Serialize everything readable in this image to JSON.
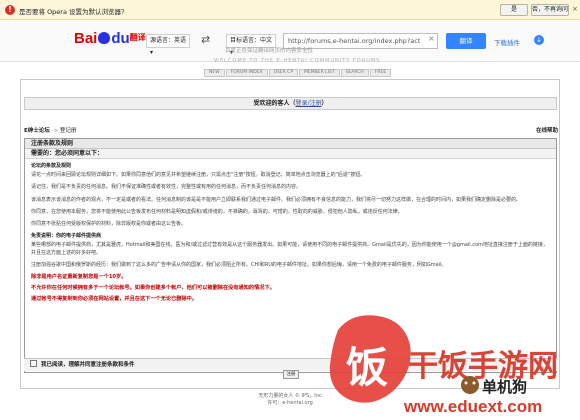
{
  "notify_bar": {
    "message": "是否要将 Opera 设置为默认浏览器？",
    "yes_label": "是",
    "no_label": "否，不再询问",
    "close_glyph": "×"
  },
  "translate_bar": {
    "logo_bai": "Bai",
    "logo_du": "du",
    "logo_fanyi": "翻译",
    "source_lang": "源语言：英语 ▾",
    "swap_glyph": "⇄",
    "target_lang": "目标语言：中文 ▾",
    "url_value": "http://forums.e-hentai.org/index.php?act",
    "clear_glyph": "×",
    "translate_button": "翻译",
    "download_plugin": "下载插件",
    "download_glyph": "↓",
    "hint": "百度正在保证翻译网页的内容安全性"
  },
  "forum_header": {
    "caption": "WELCOME TO THE E-HENTAI COMMUNITY FORUMS",
    "nav": [
      "NEW",
      "FORUM INDEX",
      "USER CP",
      "MEMBER LIST",
      "SEARCH",
      "FREE"
    ]
  },
  "welcome": {
    "text": "受欢迎的客人（",
    "link": "登录/注册",
    "text_end": "）"
  },
  "breadcrumb": {
    "home": "E绅士论坛",
    "sep": "->",
    "current": "登记册"
  },
  "faq_link": "在线帮助",
  "panel": {
    "title": "注册条款及规则",
    "subtitle": "需要的：您必须同意以下：",
    "section1_title": "论坛的条款及规则",
    "para1": "请花一点时间来回顾论坛规则详细如下。如果你同意他们的意见并希望继续注册，只需点击\"注册\"按钮。取消登记，简单地点击浏览器上的\"后退\"按钮。",
    "para2": "请记住，我们是不负责的任何消息。我们不保证准确性或者有效性，完整性或有用的任何消息，而不负责任何消息的内容。",
    "para3": "该消息表示该消息的作者的观点，不一定是或者的看法。任何消息制的该是是不能用户立即联系我们通过电子邮件。我们必须拥有不良信息的能力，我们将尽一切努力这样做，在合理的时间内，如果我们确定删除是必要的。",
    "para4": "你同意，在您使用本服务，您将不能使用此公告板发布任何材料是明知虚假和/或诽谤的，不准确的，辱骂的，可憎的，性取向的威胁，侵犯他人隐私，或违反任何法律。",
    "para5": "你同意不张贴任何受版权保护的材料，除非版权是你或者由这公告板。",
    "section2_title": "免责说明：你的电子邮件提供商",
    "para6": "某些哪部的电子邮件提供商，尤其是雅虎，Hotmail和美国在线，医为和/或过滤过营有效是从这个服务器发出。如果可能，请使用不同的电子邮件提供商。Gmail是优先的，因为你能使用一个@gmail.com地址直接注册于上面的链接，并且在这方面上述的好多好吧。",
    "para7": "注册加强谷歌中国和俄罗斯的经历：我们做到了这么多的广告申请从你的国家，我们必须阻止所有。CHI和RU的电子邮件地址。如果你想后悔，请用一个免费的电子邮件服务，例如Gmail。",
    "red1": "除非是用户名证重新复制您是一个10岁。",
    "red2": "不允许你在任何时候拥有多于一个论坛帐号。如果你创建多个帐户，他们可以被删除在没有通知的情况下。",
    "red3": "通过帐号不得复制到你必须在网站设置，并且在这下一个无论已删除中。",
    "agree_label": "我已阅读，理解并同意注册条款和条件",
    "register_button": "注册"
  },
  "footer": {
    "line1": "无形力量的女人 © IPS，Inc",
    "line2": "许可：e-hentai.org"
  },
  "watermark": {
    "brand": "干饭手游网",
    "url": "www.eduext.com",
    "logo_char": "饭",
    "secondary": "单机狗"
  },
  "colors": {
    "baidu_red": "#e10601",
    "baidu_blue": "#2932e1",
    "translate_blue": "#3385ff",
    "warning_red": "#c00000",
    "watermark_red": "#d63b2c"
  }
}
